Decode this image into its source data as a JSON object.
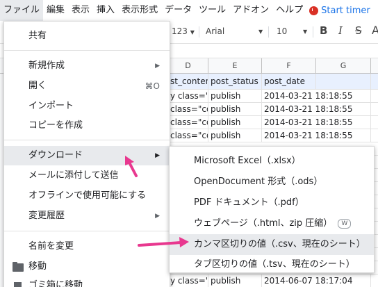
{
  "menubar": {
    "items": [
      "ファイル",
      "編集",
      "表示",
      "挿入",
      "表示形式",
      "データ",
      "ツール",
      "アドオン",
      "ヘルプ"
    ],
    "timer_label": "Start timer"
  },
  "toolbar": {
    "number_format": "123",
    "font": "Arial",
    "font_size": "10",
    "bold": "B",
    "italic": "I",
    "strike": "S"
  },
  "sheet": {
    "columns": [
      "D",
      "E",
      "F",
      "G"
    ],
    "header_row": [
      "st_content",
      "post_status",
      "post_date"
    ],
    "rows": [
      [
        "y class=\"co",
        "publish",
        "2014-03-21 18:18:55"
      ],
      [
        "class=\"co",
        "publish",
        "2014-03-21 18:18:55"
      ],
      [
        "class=\"co",
        "publish",
        "2014-03-21 18:18:55"
      ],
      [
        "class=\"co",
        "publish",
        "2014-03-21 18:18:55"
      ]
    ],
    "bottom_row": [
      "y class=\"fa",
      "publish",
      "2014-06-07 18:17:04"
    ]
  },
  "file_menu": {
    "share": "共有",
    "new": "新規作成",
    "open": "開く",
    "open_shortcut": "⌘O",
    "import": "インポート",
    "make_copy": "コピーを作成",
    "download": "ダウンロード",
    "email_attachment": "メールに添付して送信",
    "offline": "オフラインで使用可能にする",
    "version_history": "変更履歴",
    "rename": "名前を変更",
    "move": "移動",
    "trash": "ゴミ箱に移動"
  },
  "download_menu": {
    "xlsx": "Microsoft Excel（.xlsx）",
    "ods": "OpenDocument 形式（.ods）",
    "pdf": "PDF ドキュメント（.pdf）",
    "html": "ウェブページ（.html、zip 圧縮）",
    "html_shortcut": "W",
    "csv": "カンマ区切りの値（.csv、現在のシート）",
    "tsv": "タブ区切りの値（.tsv、現在のシート）"
  },
  "colors": {
    "highlight": "#e8eaed",
    "annotation_arrow": "#e8388f",
    "timer_icon": "#d93025",
    "timer_text": "#1a73e8"
  }
}
